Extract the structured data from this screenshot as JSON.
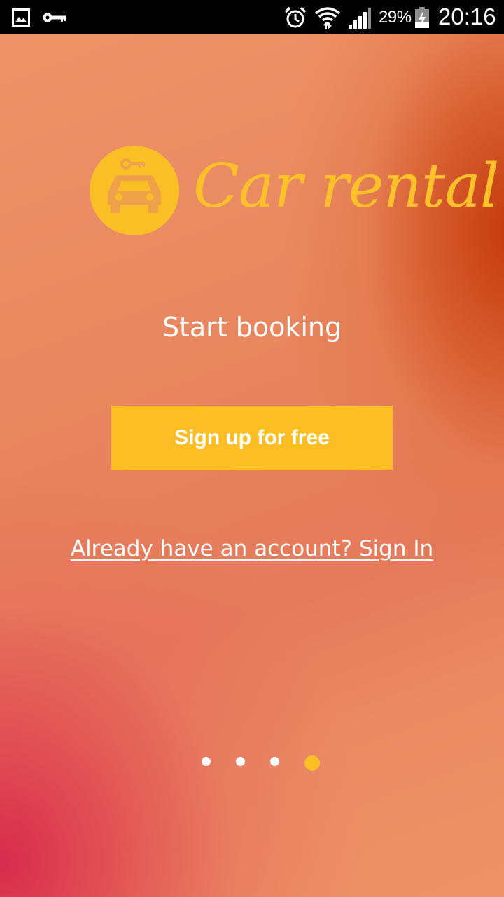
{
  "status_bar": {
    "left_icons": [
      "gallery-icon",
      "vpn-key-icon"
    ],
    "right_icons": [
      "alarm-icon",
      "wifi-icon",
      "signal-icon",
      "battery-icon"
    ],
    "battery_percent": "29%",
    "time": "20:16"
  },
  "logo": {
    "icon": "car-key-icon",
    "text": "Car rental",
    "color": "#fbbf26"
  },
  "headline": "Start booking",
  "signup_button": {
    "label": "Sign up for free",
    "color": "#fdbe25"
  },
  "signin_link": "Already have an account? Sign In",
  "pager": {
    "total": 4,
    "active_index": 4,
    "active_color": "#fbbf26",
    "inactive_color": "#ffffff"
  },
  "colors": {
    "background_orange": "#e8855e",
    "background_red": "#d6264c",
    "background_dark_orange": "#c23608"
  }
}
